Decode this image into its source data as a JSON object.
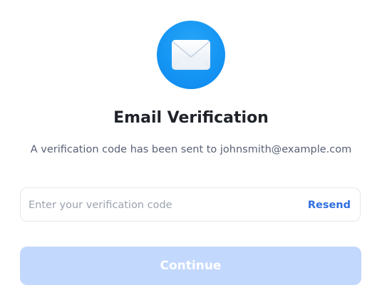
{
  "header": {
    "icon": "envelope-icon",
    "icon_color": "#1595f3",
    "title": "Email Verification",
    "subtitle": "A verification code has been sent to johnsmith@example.com"
  },
  "form": {
    "code_value": "",
    "code_placeholder": "Enter your verification code",
    "resend_label": "Resend",
    "resend_color": "#2f6fe0",
    "continue_label": "Continue",
    "continue_color": "#c3d8fd",
    "continue_disabled": true
  }
}
